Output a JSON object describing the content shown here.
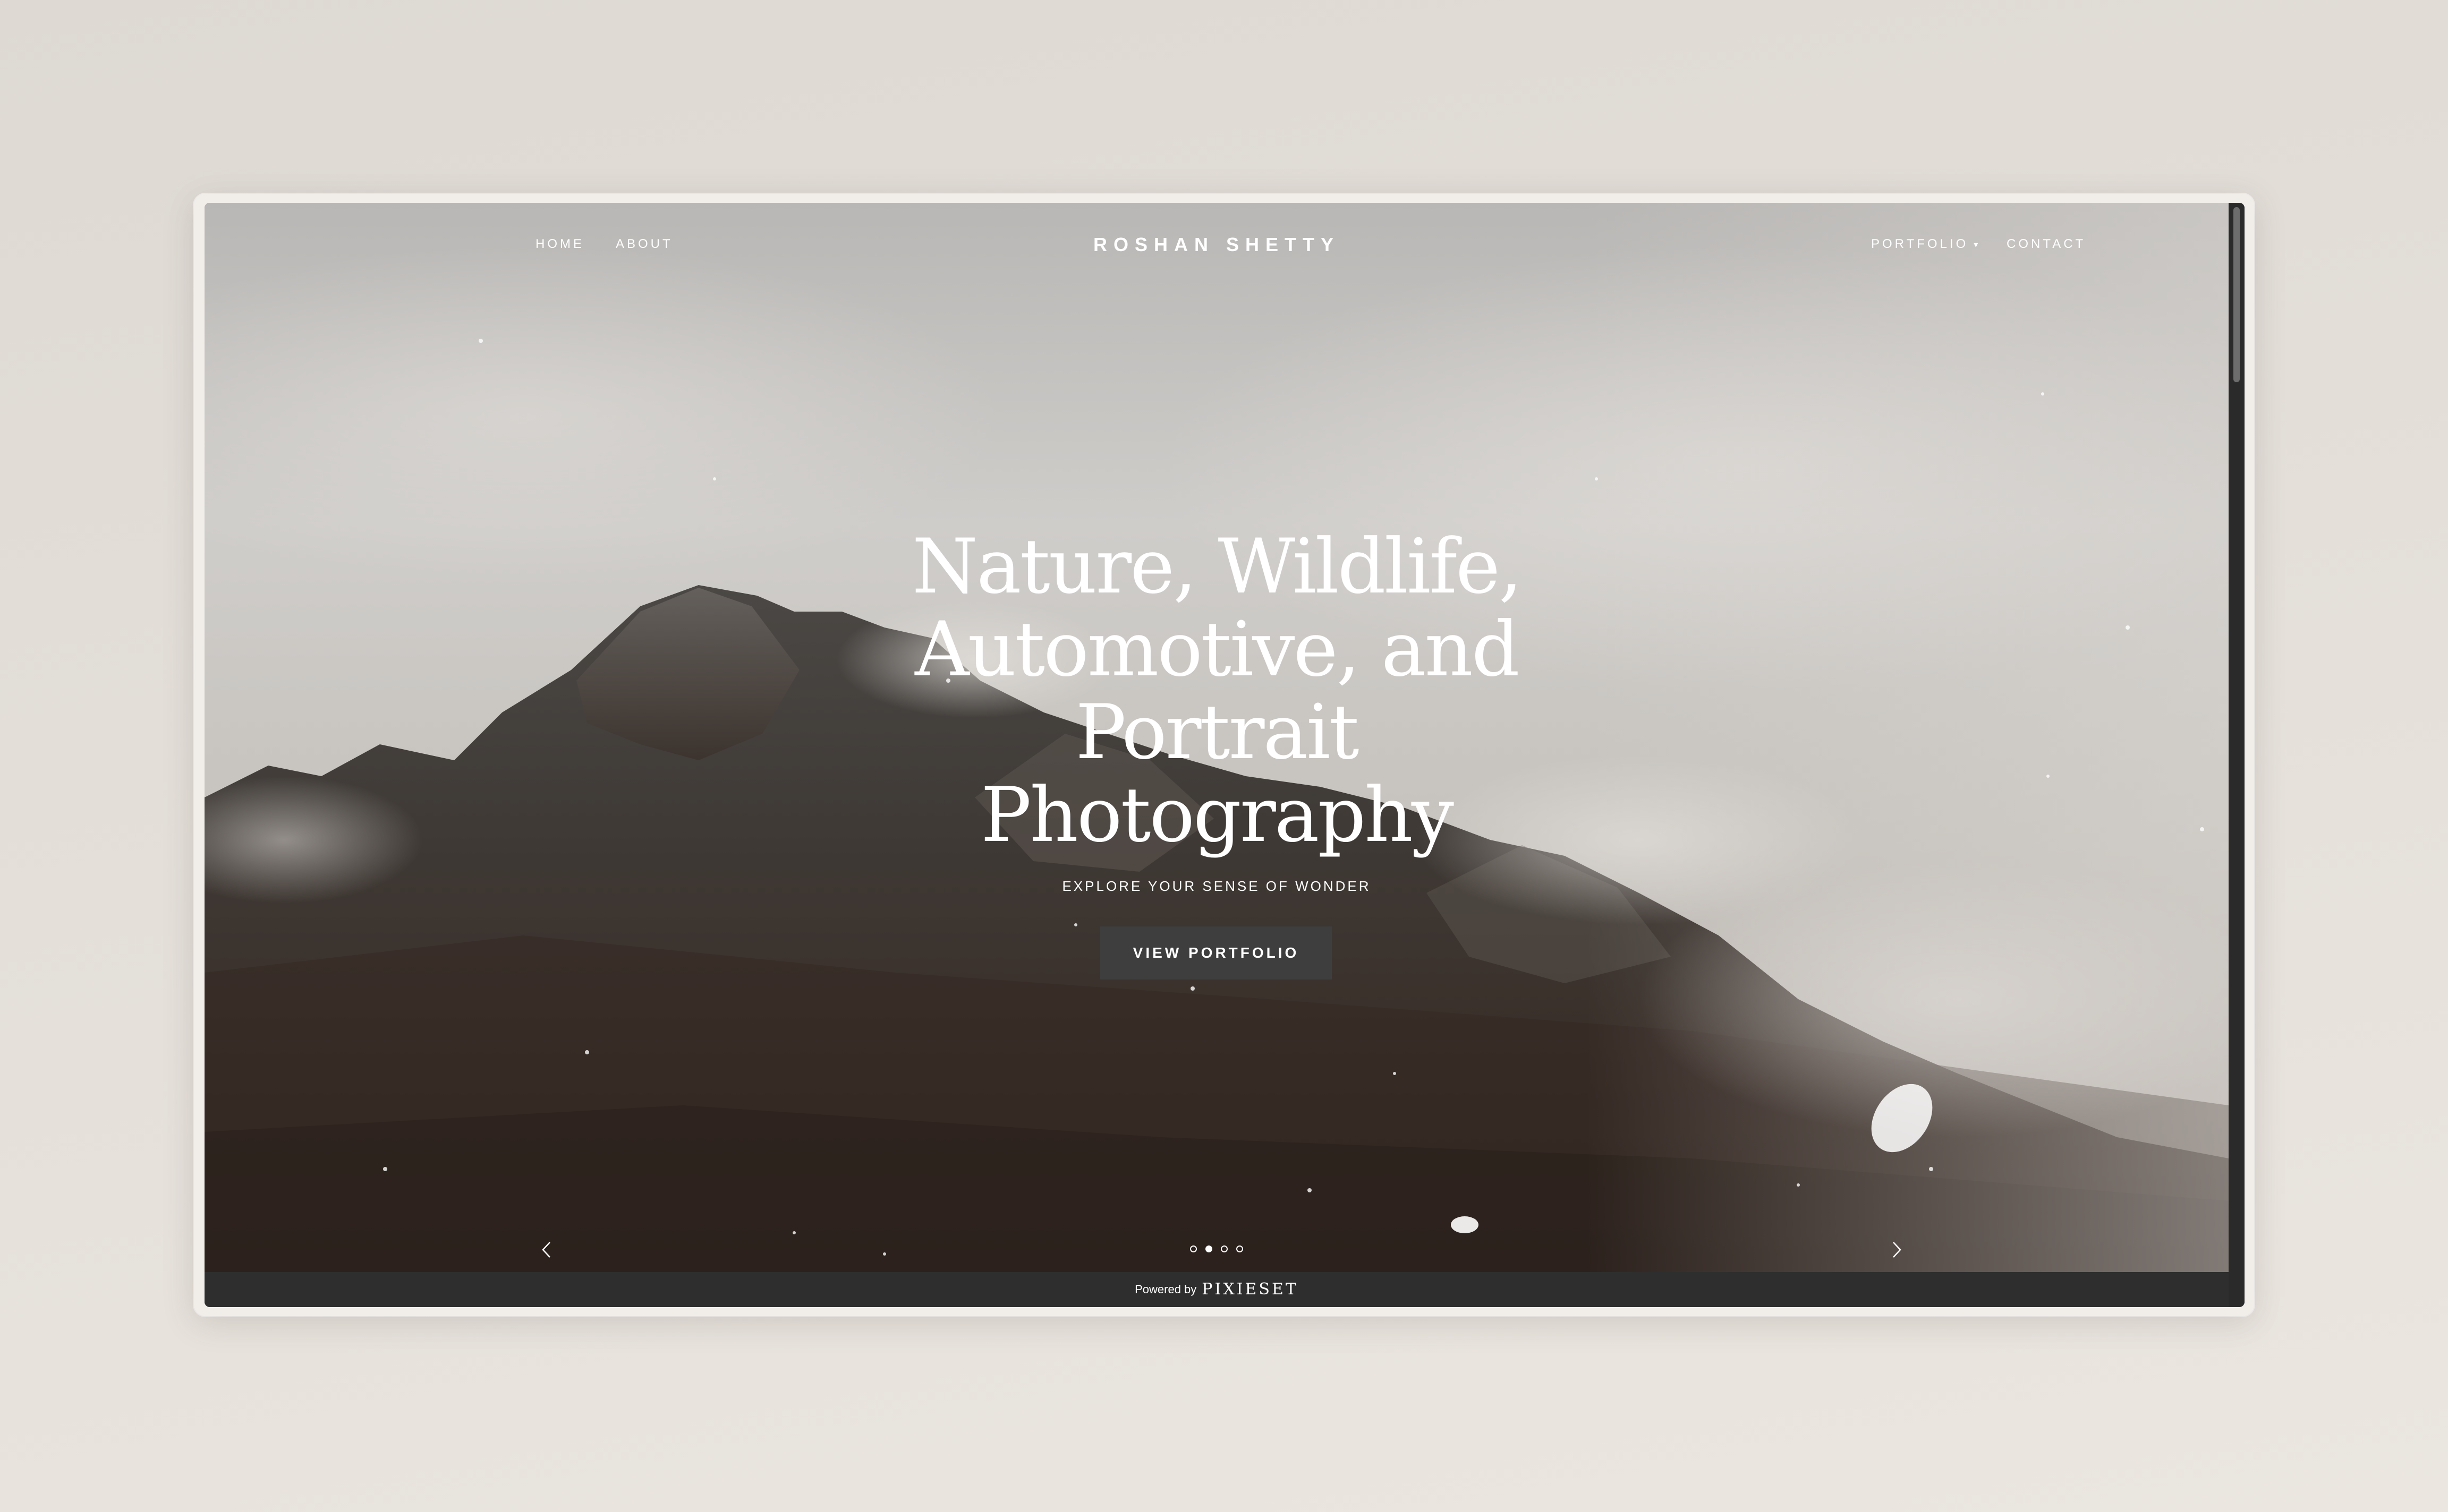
{
  "header": {
    "nav_left": [
      "HOME",
      "ABOUT"
    ],
    "brand": "ROSHAN SHETTY",
    "nav_right": {
      "portfolio": "PORTFOLIO",
      "contact": "CONTACT"
    }
  },
  "hero": {
    "headline_lines": [
      "Nature, Wildlife,",
      "Automotive, and",
      "Portrait",
      "Photography"
    ],
    "tagline": "EXPLORE YOUR SENSE OF WONDER",
    "cta_label": "VIEW PORTFOLIO",
    "slides": {
      "count": 4,
      "active_index": 1
    },
    "icons": {
      "prev": "chevron-left-icon",
      "next": "chevron-right-icon",
      "dropdown": "caret-down-icon"
    }
  },
  "footer": {
    "powered_by": "Powered by",
    "provider": "PIXIESET"
  },
  "colors": {
    "page_background": "#e3ded8",
    "footer_bar": "#2e2e2e",
    "button": "#3e3e3e",
    "text": "#ffffff"
  }
}
